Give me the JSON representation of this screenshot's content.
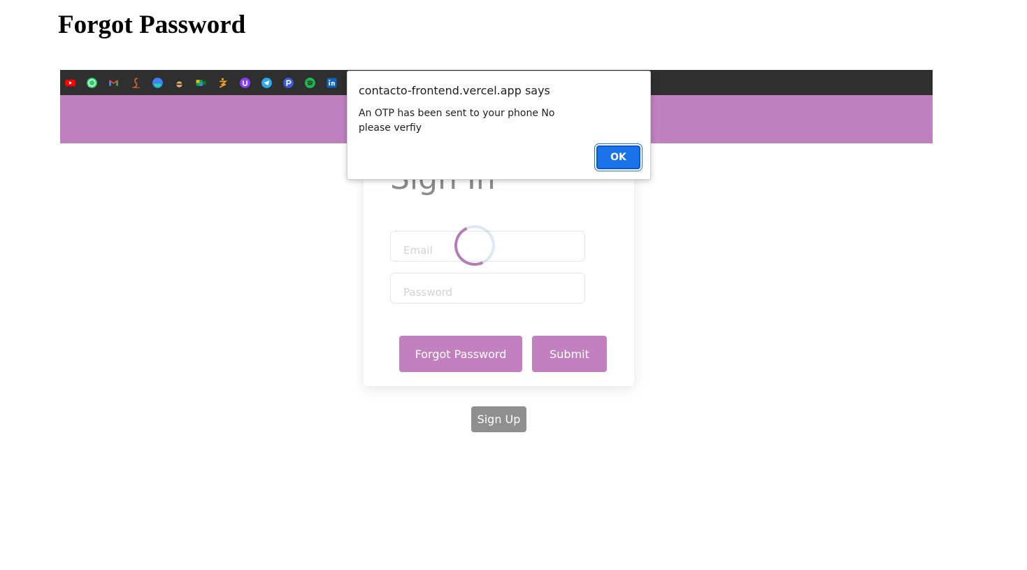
{
  "document": {
    "title": "Forgot Password"
  },
  "bookmarks": [
    {
      "icon": "youtube-icon",
      "color": "#ff0000"
    },
    {
      "icon": "whatsapp-icon",
      "color": "#25d366"
    },
    {
      "icon": "gmail-icon",
      "color": "#ea4335"
    },
    {
      "icon": "stackedit-icon",
      "color": "#c9622a"
    },
    {
      "icon": "firefox-relay-icon",
      "color": "#3b82f6"
    },
    {
      "icon": "ninja-icon",
      "color": "#e0b070"
    },
    {
      "icon": "google-meet-icon",
      "color": "#00ac47"
    },
    {
      "icon": "duck-icon",
      "color": "#f5a623"
    },
    {
      "icon": "purple-u-icon",
      "color": "#8a3ffc"
    },
    {
      "icon": "telegram-icon",
      "color": "#2aabee"
    },
    {
      "icon": "pcloud-icon",
      "color": "#3c5bd6"
    },
    {
      "icon": "spotify-icon",
      "color": "#1db954"
    },
    {
      "icon": "linkedin-icon",
      "color": "#0a66c2"
    }
  ],
  "colors": {
    "brand": "#c080bf",
    "bookmark_bar": "#2f2f2f",
    "signup": "#8f8f8f",
    "ok": "#1a73e8"
  },
  "signin": {
    "title": "Sign In",
    "email_placeholder": "Email",
    "password_placeholder": "Password",
    "forgot_label": "Forgot Password",
    "submit_label": "Submit",
    "signup_label": "Sign Up"
  },
  "dialog": {
    "title": "contacto-frontend.vercel.app says",
    "message": "An OTP has been sent to your phone No please verfiy",
    "ok_label": "OK"
  }
}
